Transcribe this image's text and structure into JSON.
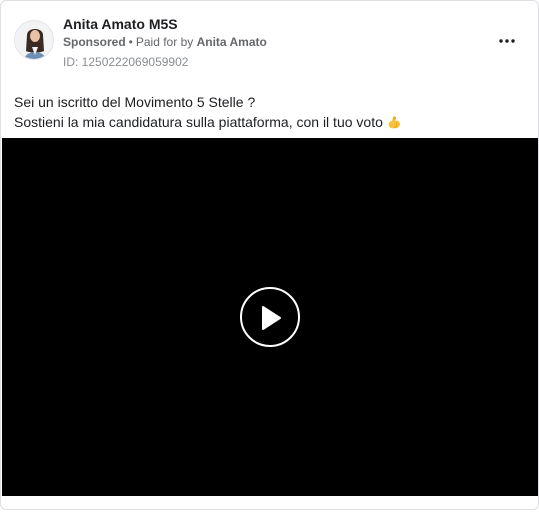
{
  "ad": {
    "page_name": "Anita Amato M5S",
    "sponsored_label": "Sponsored",
    "separator": "•",
    "paid_for_prefix": "Paid for by",
    "paid_for_name": "Anita Amato",
    "ad_id": "ID: 1250222069059902",
    "body_lines": [
      "Sei un iscritto del Movimento 5 Stelle ?",
      "Sostieni la mia candidatura sulla piattaforma, con il tuo voto"
    ],
    "emoji_icon": "flexed-biceps-icon",
    "menu_icon": "more-options-icon",
    "media": {
      "type": "video",
      "background": "#000000",
      "control_icon": "play-icon"
    }
  },
  "colors": {
    "name": "#1c1e21",
    "meta": "#65676b",
    "id": "#8a8d91",
    "border": "#dddfe2",
    "video_bg": "#000000"
  }
}
